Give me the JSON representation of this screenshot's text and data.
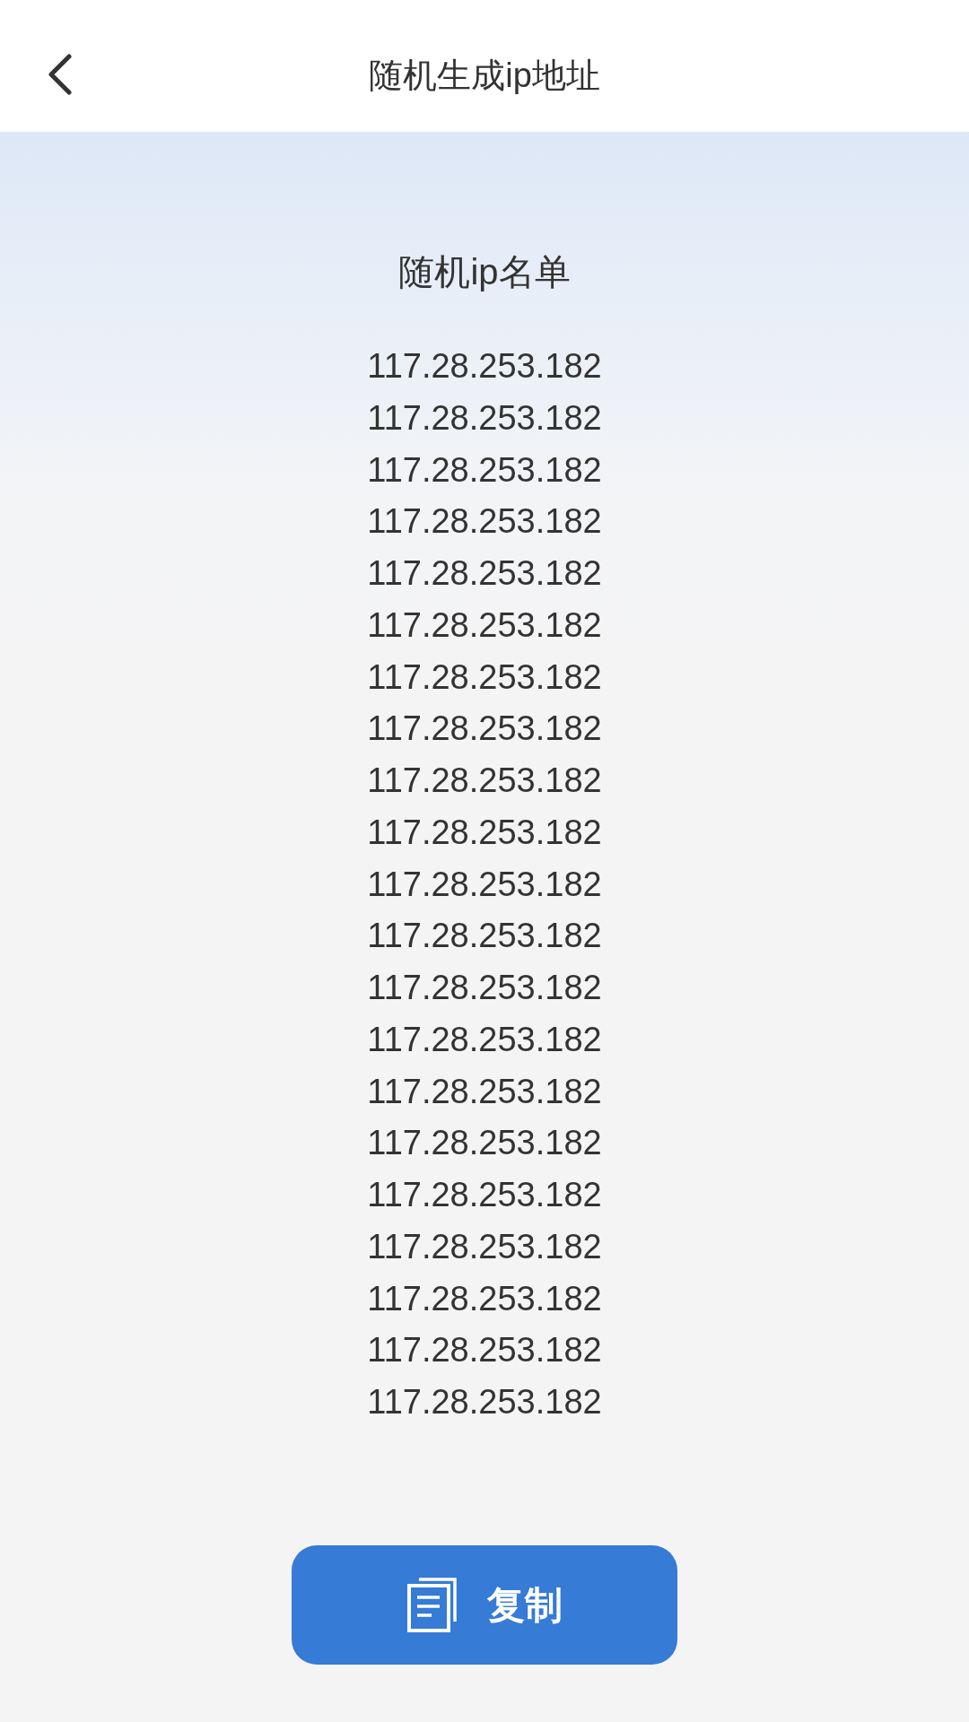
{
  "header": {
    "title": "随机生成ip地址"
  },
  "list": {
    "title": "随机ip名单",
    "items": [
      "117.28.253.182",
      "117.28.253.182",
      "117.28.253.182",
      "117.28.253.182",
      "117.28.253.182",
      "117.28.253.182",
      "117.28.253.182",
      "117.28.253.182",
      "117.28.253.182",
      "117.28.253.182",
      "117.28.253.182",
      "117.28.253.182",
      "117.28.253.182",
      "117.28.253.182",
      "117.28.253.182",
      "117.28.253.182",
      "117.28.253.182",
      "117.28.253.182",
      "117.28.253.182",
      "117.28.253.182",
      "117.28.253.182"
    ]
  },
  "copy_button": {
    "label": "复制"
  }
}
